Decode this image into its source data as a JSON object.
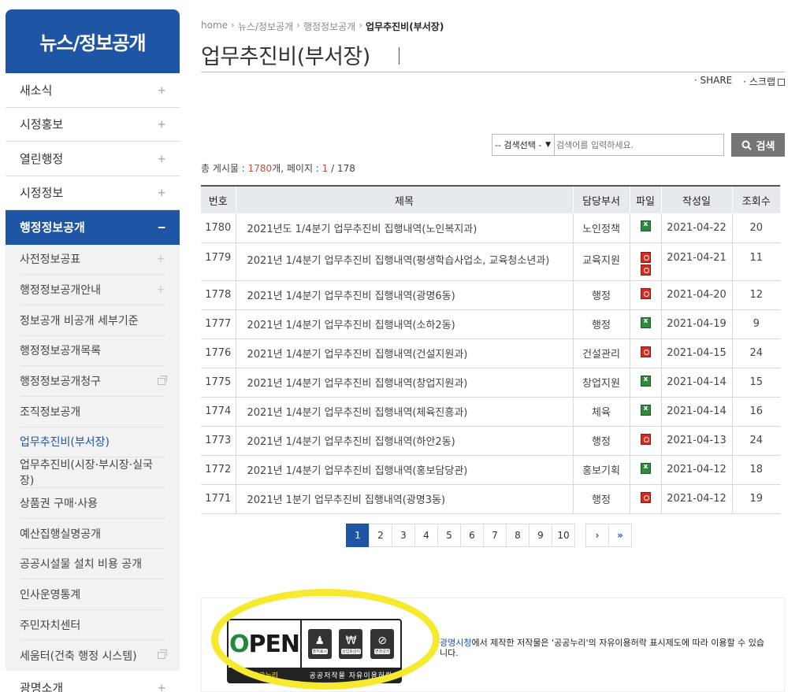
{
  "sidebar": {
    "title": "뉴스/정보공개",
    "menu_top": [
      {
        "label": "새소식",
        "toggle": "+"
      },
      {
        "label": "시정홍보",
        "toggle": "+"
      },
      {
        "label": "열린행정",
        "toggle": "+"
      },
      {
        "label": "시정정보",
        "toggle": "+"
      }
    ],
    "active": {
      "label": "행정정보공개",
      "toggle": "−"
    },
    "submenu": [
      {
        "label": "사전정보공표",
        "icon": "+"
      },
      {
        "label": "행정정보공개안내",
        "icon": "+"
      },
      {
        "label": "정보공개 비공개 세부기준",
        "icon": ""
      },
      {
        "label": "행정정보공개목록",
        "icon": ""
      },
      {
        "label": "행정정보공개청구",
        "icon": "window"
      },
      {
        "label": "조직정보공개",
        "icon": ""
      },
      {
        "label": "업무추진비(부서장)",
        "icon": ""
      },
      {
        "label": "업무추진비(시장·부시장·실국장)",
        "icon": ""
      },
      {
        "label": "상품권 구매·사용",
        "icon": ""
      },
      {
        "label": "예산집행실명공개",
        "icon": ""
      },
      {
        "label": "공공시설물 설치 비용 공개",
        "icon": ""
      },
      {
        "label": "인사운영통계",
        "icon": ""
      },
      {
        "label": "주민자치센터",
        "icon": ""
      },
      {
        "label": "세움터(건축 행정 시스템)",
        "icon": "window"
      }
    ],
    "menu_bottom": [
      {
        "label": "광명소개",
        "toggle": "+"
      }
    ]
  },
  "breadcrumb": [
    "home",
    "뉴스/정보공개",
    "행정정보공개",
    "업무추진비(부서장)"
  ],
  "page_title": "업무추진비(부서장)",
  "share": {
    "share_label": "· SHARE",
    "scrap_label": "· 스크랩"
  },
  "search": {
    "select_value": "-- 검색선택 -",
    "placeholder": "검색어를 입력하세요.",
    "button_label": "검색"
  },
  "count": {
    "prefix": "총 게시물 : ",
    "total": "1780",
    "mid": "개, 페이지 : ",
    "page": "1",
    "suffix": " / 178"
  },
  "table": {
    "headers": [
      "번호",
      "제목",
      "담당부서",
      "파일",
      "작성일",
      "조회수"
    ],
    "rows": [
      {
        "no": "1780",
        "title": " 2021년도 1/4분기 업무추진비 집행내역(노인복지과)",
        "dept": "노인정책",
        "files": [
          "xls"
        ],
        "date": "2021-04-22",
        "views": "20"
      },
      {
        "no": "1779",
        "title": "2021년 1/4분기 업무추진비 집행내역(평생학습사업소, 교육청소년과)",
        "dept": "교육지원",
        "files": [
          "pdf",
          "pdf"
        ],
        "date": "2021-04-21",
        "views": "11"
      },
      {
        "no": "1778",
        "title": "2021년 1/4분기 업무추진비 집행내역(광명6동)",
        "dept": "행정",
        "files": [
          "pdf"
        ],
        "date": "2021-04-20",
        "views": "12"
      },
      {
        "no": "1777",
        "title": "2021년 1/4분기 업무추진비 집행내역(소하2동)",
        "dept": "행정",
        "files": [
          "xls"
        ],
        "date": "2021-04-19",
        "views": "9"
      },
      {
        "no": "1776",
        "title": "2021년 1/4분기 업무추진비 집행내역(건설지원과)",
        "dept": "건설관리",
        "files": [
          "pdf"
        ],
        "date": "2021-04-15",
        "views": "24"
      },
      {
        "no": "1775",
        "title": "2021년 1/4분기 업무추진비 집행내역(창업지원과)",
        "dept": "창업지원",
        "files": [
          "xls"
        ],
        "date": "2021-04-14",
        "views": "15"
      },
      {
        "no": "1774",
        "title": "2021년 1/4분기 업무추진비 집행내역(체육진흥과)",
        "dept": "체육",
        "files": [
          "xls"
        ],
        "date": "2021-04-14",
        "views": "16"
      },
      {
        "no": "1773",
        "title": "2021년 1/4분기 업무추진비 집행내역(하안2동)",
        "dept": "행정",
        "files": [
          "pdf"
        ],
        "date": "2021-04-13",
        "views": "24"
      },
      {
        "no": "1772",
        "title": "2021년 1/4분기 업무추진비 집행내역(홍보담당관)",
        "dept": "홍보기획",
        "files": [
          "xls"
        ],
        "date": "2021-04-12",
        "views": "18"
      },
      {
        "no": "1771",
        "title": "2021년 1분기 업무추진비 집행내역(광명3동)",
        "dept": "행정",
        "files": [
          "pdf"
        ],
        "date": "2021-04-12",
        "views": "19"
      }
    ]
  },
  "pagination": {
    "pages": [
      "1",
      "2",
      "3",
      "4",
      "5",
      "6",
      "7",
      "8",
      "9",
      "10"
    ],
    "current": "1",
    "next": "›",
    "last": "»"
  },
  "license": {
    "logo_word": "OPEN",
    "logo_caption_left": "공공누리",
    "logo_caption_right": "공공저작물 자유이용허락",
    "badges": [
      "출처표시",
      "상업용금지",
      "변경금지"
    ],
    "org": "광명시청",
    "text": "에서 제작한 저작물은 '공공누리'의 자유이용허락 표시제도에 따라 이용할 수 있습니다."
  },
  "colors": {
    "brand": "#1f55a5",
    "highlight": "#f5ea2f",
    "count_accent": "#d44a1f"
  }
}
